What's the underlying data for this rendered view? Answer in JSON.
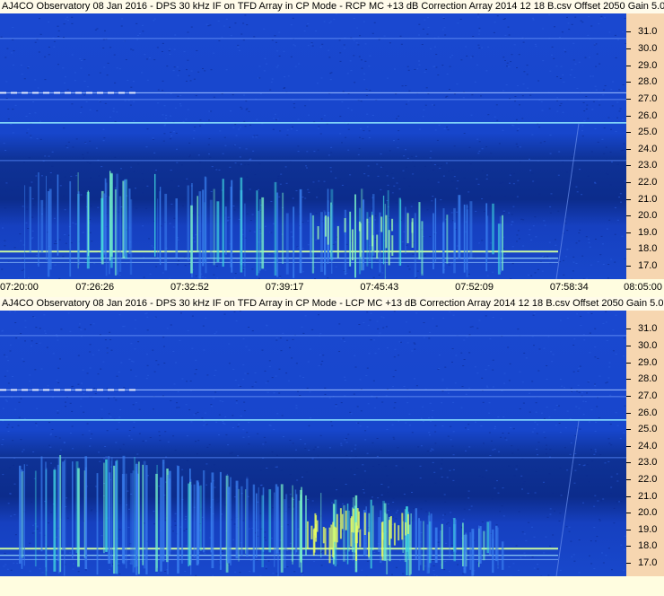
{
  "chart_data": [
    {
      "type": "heatmap",
      "title": "AJ4CO Observatory 08 Jan 2016 - DPS 30 kHz IF on TFD Array in CP Mode - RCP  MC +13 dB  Correction Array 2014 12 18 B.csv  Offset 2050  Gain 5.0",
      "yticks": [
        "31.0",
        "30.0",
        "29.0",
        "28.0",
        "27.0",
        "26.0",
        "25.0",
        "24.0",
        "23.0",
        "22.0",
        "21.0",
        "20.0",
        "19.0",
        "18.0",
        "17.0"
      ],
      "xticks": [
        "07:20:00",
        "07:26:26",
        "07:32:52",
        "07:39:17",
        "07:45:43",
        "07:52:09",
        "07:58:34",
        "08:05:00"
      ],
      "ylim": [
        16.2,
        32.1
      ],
      "xlim": [
        "07:20:00",
        "08:05:00"
      ]
    },
    {
      "type": "heatmap",
      "title": "AJ4CO Observatory 08 Jan 2016 - DPS 30 kHz IF on TFD Array in CP Mode - LCP  MC +13 dB  Correction Array 2014 12 18 B.csv  Offset 2050  Gain 5.0",
      "yticks": [
        "31.0",
        "30.0",
        "29.0",
        "28.0",
        "27.0",
        "26.0",
        "25.0",
        "24.0",
        "23.0",
        "22.0",
        "21.0",
        "20.0",
        "19.0",
        "18.0",
        "17.0"
      ],
      "ylim": [
        16.2,
        32.1
      ],
      "xlim": [
        "07:20:00",
        "08:05:00"
      ]
    }
  ],
  "colors": {
    "background_blue": "#1540c8",
    "dark_band": "#0a2a8a",
    "bright": "#a8f0ff",
    "burst": "#40e0c0",
    "axis_panel": "#f6d6b0"
  }
}
